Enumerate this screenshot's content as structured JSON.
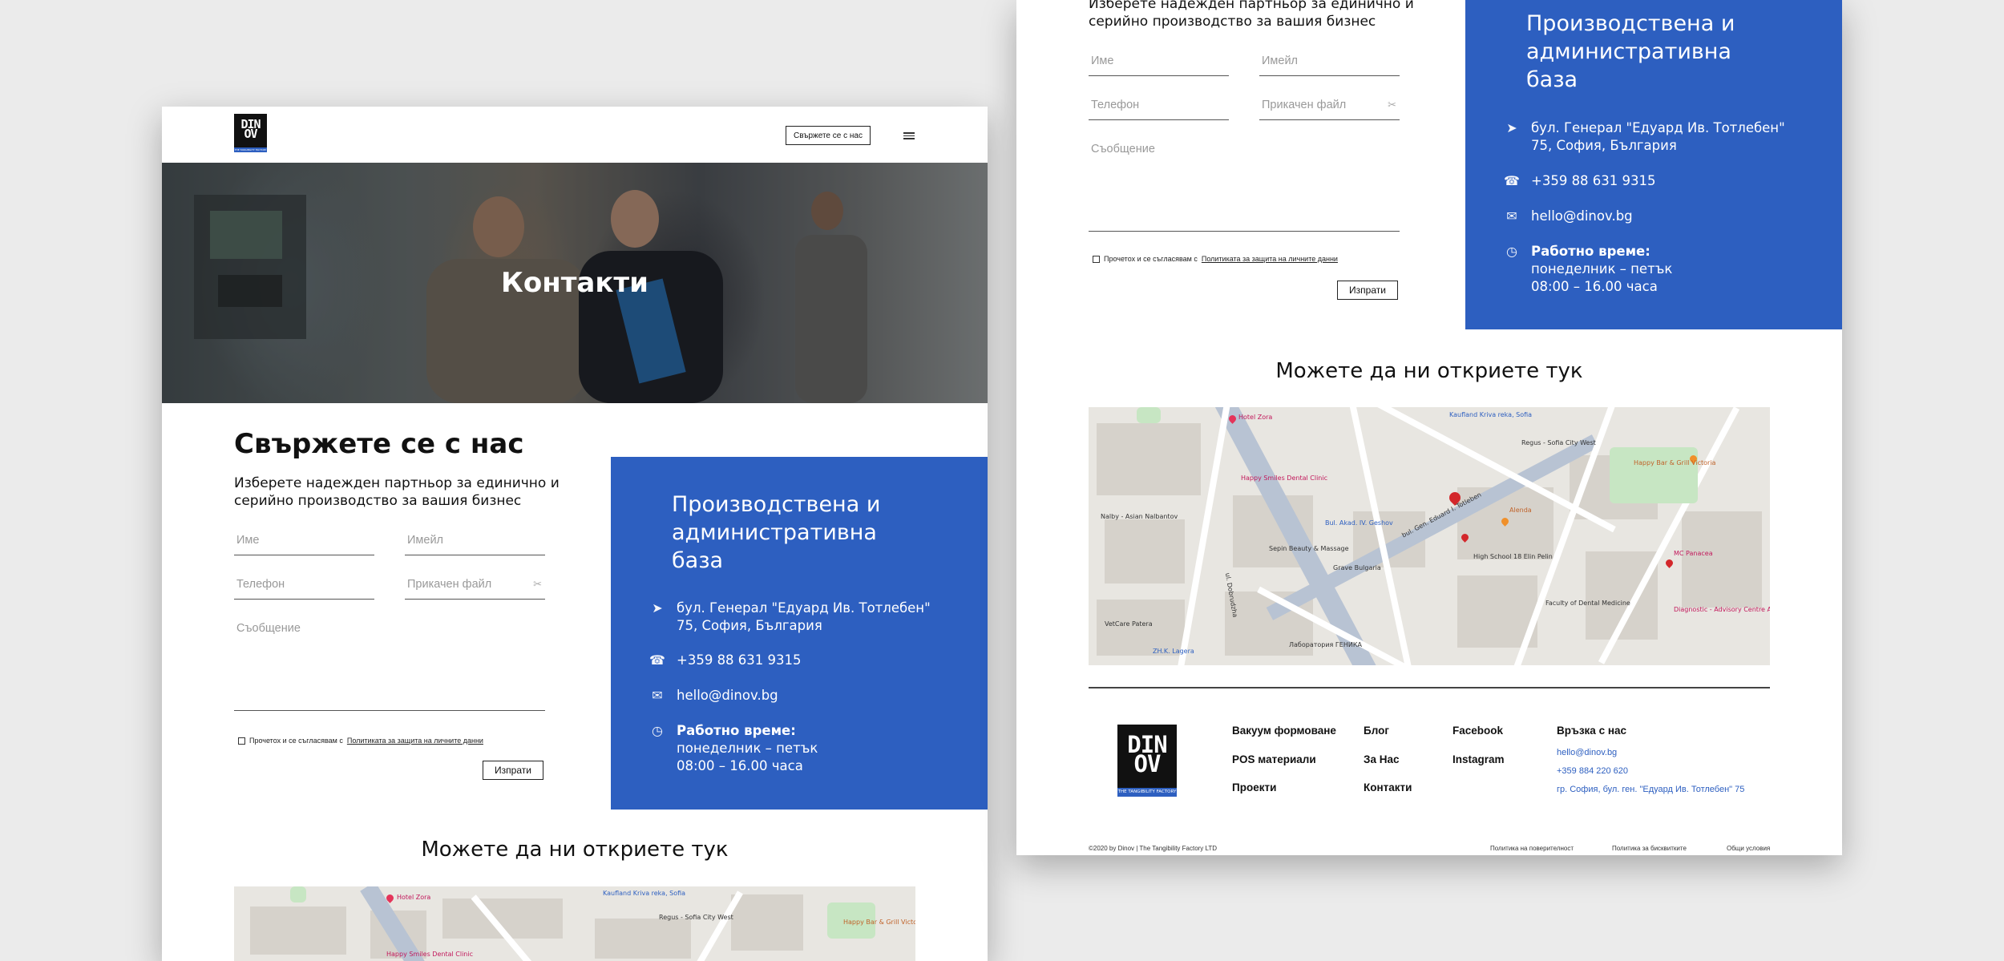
{
  "header": {
    "logo_top": "DIN",
    "logo_bottom": "OV",
    "logo_tagline": "THE TANGIBILITY FACTORY",
    "contact_button": "Свържете се с нас"
  },
  "hero": {
    "title": "Контакти"
  },
  "contact_form": {
    "heading": "Свържете се с нас",
    "lead_line1": "Изберете надежден партньор за единично и",
    "lead_line2": "серийно производство за вашия бизнес",
    "name_placeholder": "Име",
    "email_placeholder": "Имейл",
    "phone_placeholder": "Телефон",
    "file_placeholder": "Прикачен файл",
    "message_placeholder": "Съобщение",
    "consent_prefix": "Прочетох и се съгласявам с",
    "consent_link": "Политиката за защита на личните данни",
    "submit": "Изпрати"
  },
  "panel": {
    "title_line1": "Производствена и",
    "title_line2": "административна",
    "title_line3": "база",
    "address_line1": "бул. Генерал \"Едуард Ив. Тотлебен\"",
    "address_line2": "75, София, България",
    "phone": "+359 88 631 9315",
    "email": "hello@dinov.bg",
    "hours_label": "Работно време:",
    "hours_days": "понеделник – петък",
    "hours_time": "08:00 – 16.00 часа"
  },
  "map": {
    "title": "Можете да ни откриете тук",
    "labels": [
      "Hotel Zora",
      "Kaufland Kriva reka, Sofia",
      "Regus - Sofia City West",
      "Happy Bar & Grill Victoria",
      "Happy Smiles Dental Clinic",
      "Nalby - Asian Nalbantov",
      "Bul. Akad. IV. Geshov",
      "Sepin Beauty & Massage",
      "Grave Bulgaria",
      "Alenda",
      "High School 18 Elin Pelin",
      "MC Panacea",
      "Diagnostic - Advisory Centre Aleksandrovska",
      "Faculty of Dental Medicine",
      "ZH.K. Lagera",
      "VetCare Patera",
      "Лаборатория ГЕНИКА",
      "bul. Gen. Eduard I. Totleben",
      "ul. Dobrudzha"
    ]
  },
  "footer": {
    "col1": [
      "Вакуум формоване",
      "POS материали",
      "Проекти"
    ],
    "col2": [
      "Блог",
      "За Нас",
      "Контакти"
    ],
    "col3": [
      "Facebook",
      "Instagram"
    ],
    "contact_title": "Връзка с нас",
    "contact_email": "hello@dinov.bg",
    "contact_phone": "+359 884 220 620",
    "contact_address": "гр. София, бул. ген. \"Едуард Ив. Тотлебен\" 75",
    "copyright": "©2020 by Dinov | The Tangibility Factory LTD",
    "privacy": "Политика на поверителност",
    "cookies": "Политика за бисквитките",
    "terms": "Общи условия"
  },
  "colors": {
    "brand_blue": "#2d5fc0",
    "background": "#ebebeb"
  }
}
